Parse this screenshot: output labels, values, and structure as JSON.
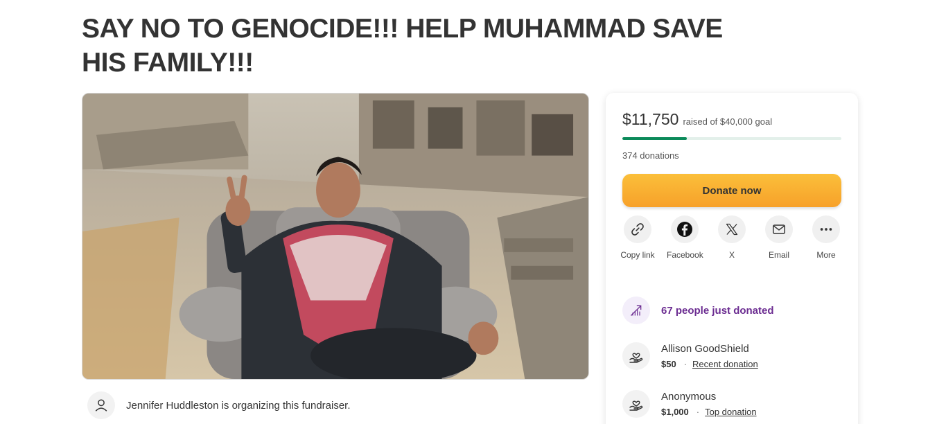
{
  "campaign": {
    "title": "SAY NO TO GENOCIDE!!! HELP MUHAMMAD SAVE HIS FAMILY!!!",
    "organizer_text": "Jennifer Huddleston is organizing this fundraiser."
  },
  "donation_card": {
    "raised_amount": "$11,750",
    "raised_goal_text": "raised of $40,000 goal",
    "progress_fraction": 0.294,
    "donations_count": "374 donations",
    "donate_button": "Donate now",
    "share": [
      {
        "label": "Copy link",
        "icon": "link-icon"
      },
      {
        "label": "Facebook",
        "icon": "facebook-icon"
      },
      {
        "label": "X",
        "icon": "x-icon"
      },
      {
        "label": "Email",
        "icon": "email-icon"
      },
      {
        "label": "More",
        "icon": "more-icon"
      }
    ],
    "recent_activity": "67 people just donated",
    "donors": [
      {
        "name": "Allison GoodShield",
        "amount": "$50",
        "tag": "Recent donation"
      },
      {
        "name": "Anonymous",
        "amount": "$1,000",
        "tag": "Top donation"
      }
    ]
  },
  "colors": {
    "progress": "#0b8a5a",
    "donate_button": "#f7a12a",
    "recent_accent": "#6b2c91"
  }
}
